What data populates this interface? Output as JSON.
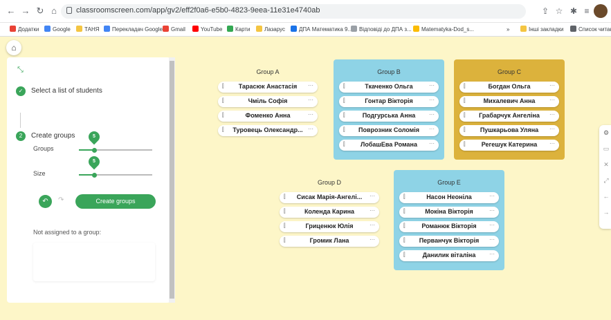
{
  "browser": {
    "url": "classroomscreen.com/app/gv2/eff2f0a6-e5b0-4823-9eea-11e31e4740ab",
    "bookmarks": [
      "Додатки",
      "Google",
      "ТАНЯ",
      "Перекладач Google",
      "Gmail",
      "YouTube",
      "Карти",
      "Лазарус",
      "ДПА Математика 9...",
      "Відповіді до ДПА з...",
      "Matematyka-Dod_s...",
      "Інші закладки",
      "Список читання"
    ],
    "more_bookmarks": "»"
  },
  "sidebar": {
    "step1_label": "Select a list of students",
    "step2_number": "2",
    "step2_label": "Create groups",
    "groups_label": "Groups",
    "groups_value": "5",
    "size_label": "Size",
    "size_value": "5",
    "create_button": "Create groups",
    "not_assigned_label": "Not assigned to a group:"
  },
  "groups": [
    {
      "title": "Group A",
      "color": "#fdf6c8",
      "members": [
        "Тарасюк Анастасія",
        "Чміль Софія",
        "Фоменко Анна",
        "Туровець Олександр..."
      ]
    },
    {
      "title": "Group B",
      "color": "#8ed3e6",
      "members": [
        "Ткаченко Ольга",
        "Гонтар Вікторія",
        "Подгурська Анна",
        "Поврозник Соломія",
        "ЛобашЕва Романа"
      ]
    },
    {
      "title": "Group C",
      "color": "#dcb23c",
      "members": [
        "Богдан Ольга",
        "Михалевич Анна",
        "Грабарчук Ангеліна",
        "Пушкарьова Уляна",
        "Регешук Катерина"
      ]
    },
    {
      "title": "Group D",
      "color": "#fdf6c8",
      "members": [
        "Сисак Марія-Ангелі...",
        "Коленда Карина",
        "Гриценюк Юлія",
        "Громик Лана"
      ]
    },
    {
      "title": "Group E",
      "color": "#8ed3e6",
      "members": [
        "Насон Неоніла",
        "Мокіна Вікторія",
        "Романюк Вікторія",
        "Перванчук Вікторія",
        "Данилик віталіна"
      ]
    }
  ],
  "icons": {
    "drag": "drag-handle-icon",
    "more": "more-icon"
  }
}
